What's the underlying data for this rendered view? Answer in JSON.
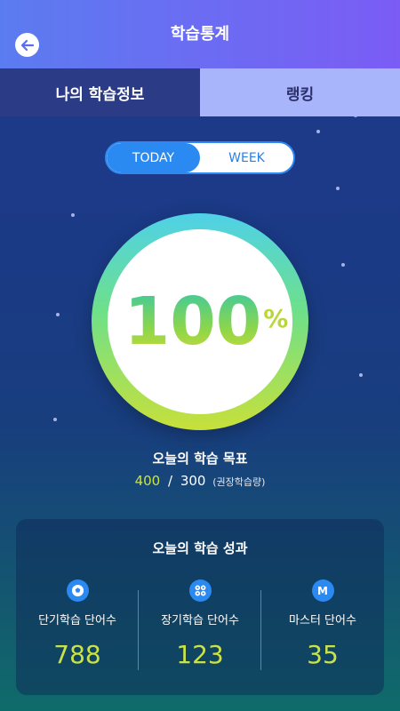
{
  "header": {
    "title": "학습통계",
    "back_icon": "arrow-left-icon"
  },
  "tabs": [
    {
      "label": "나의 학습정보",
      "active": true
    },
    {
      "label": "랭킹",
      "active": false
    }
  ],
  "period_toggle": {
    "options": [
      "TODAY",
      "WEEK"
    ],
    "selected": "TODAY"
  },
  "gauge": {
    "value": "100",
    "unit": "%"
  },
  "goal": {
    "label": "오늘의 학습 목표",
    "done": "400",
    "separator": "/",
    "total": "300",
    "note": "(권장학습량)"
  },
  "results": {
    "title": "오늘의 학습 성과",
    "items": [
      {
        "icon": "soccer-ball-icon",
        "label": "단기학습 단어수",
        "value": "788"
      },
      {
        "icon": "flower-cluster-icon",
        "label": "장기학습 단어수",
        "value": "123"
      },
      {
        "icon": "m-badge-icon",
        "icon_text": "M",
        "label": "마스터 단어수",
        "value": "35"
      }
    ]
  },
  "colors": {
    "header_start": "#5b7cf0",
    "header_end": "#7b5cf5",
    "accent_blue": "#2b8af2",
    "value_green": "#c9e24a"
  }
}
